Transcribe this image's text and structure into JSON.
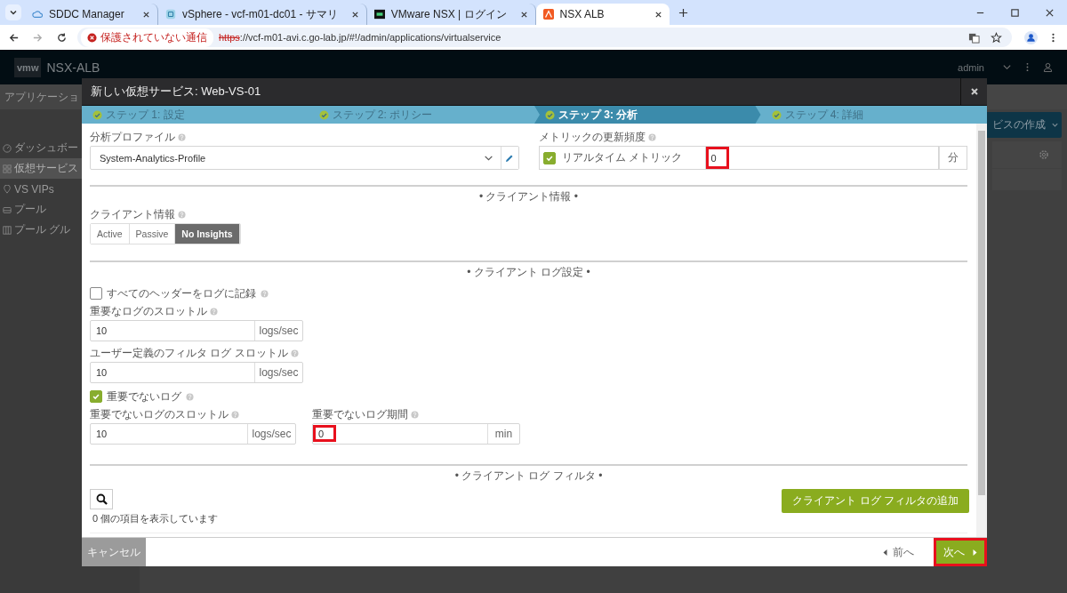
{
  "browser": {
    "tabs": [
      {
        "title": "SDDC Manager",
        "selected": false
      },
      {
        "title": "vSphere - vcf-m01-dc01 - サマリ",
        "selected": false
      },
      {
        "title": "VMware NSX | ログイン",
        "selected": false
      },
      {
        "title": "NSX ALB",
        "selected": true
      }
    ],
    "security": "保護されていない通信",
    "scheme": "https",
    "url_rest": "://vcf-m01-avi.c.go-lab.jp/#!/admin/applications/virtualservice"
  },
  "app": {
    "logo": "vmw",
    "brand": "NSX-ALB",
    "user": "admin",
    "nav_tab": "アプリケーショ",
    "sidebar": [
      {
        "label": "ダッシュボー",
        "selected": false
      },
      {
        "label": "仮想サービス",
        "selected": true
      },
      {
        "label": "VS VIPs",
        "selected": false
      },
      {
        "label": "プール",
        "selected": false
      },
      {
        "label": "プール グル",
        "selected": false
      }
    ],
    "create_button": "ビスの作成"
  },
  "modal": {
    "title": "新しい仮想サービス: Web-VS-01",
    "steps": [
      {
        "label": "ステップ 1: 設定",
        "selected": false
      },
      {
        "label": "ステップ 2: ポリシー",
        "selected": false
      },
      {
        "label": "ステップ 3: 分析",
        "selected": true
      },
      {
        "label": "ステップ 4: 詳細",
        "selected": false
      }
    ],
    "analytics_profile": {
      "label": "分析プロファイル",
      "value": "System-Analytics-Profile"
    },
    "metrics": {
      "label": "メトリックの更新頻度",
      "checkbox_label": "リアルタイム メトリック",
      "checked": true,
      "value": "0",
      "unit": "分",
      "highlighted": true
    },
    "client_insights": {
      "heading": "• クライアント情報 •",
      "label": "クライアント情報",
      "options": [
        {
          "label": "Active",
          "selected": false
        },
        {
          "label": "Passive",
          "selected": false
        },
        {
          "label": "No Insights",
          "selected": true
        }
      ]
    },
    "log_settings": {
      "heading": "• クライアント ログ設定 •",
      "log_all_headers": {
        "label": "すべてのヘッダーをログに記録",
        "checked": false
      },
      "significant_throttle": {
        "label": "重要なログのスロットル",
        "value": "10",
        "unit": "logs/sec",
        "highlighted": false
      },
      "filter_throttle": {
        "label": "ユーザー定義のフィルタ ログ スロットル",
        "value": "10",
        "unit": "logs/sec",
        "highlighted": false
      },
      "non_significant": {
        "label": "重要でないログ",
        "checked": true
      },
      "non_significant_throttle": {
        "label": "重要でないログのスロットル",
        "value": "10",
        "unit": "logs/sec",
        "highlighted": false
      },
      "non_significant_duration": {
        "label": "重要でないログ期間",
        "value": "0",
        "unit": "min",
        "highlighted": true
      }
    },
    "log_filter": {
      "heading": "• クライアント ログ フィルタ •",
      "count_text": "0 個の項目を表示しています",
      "add_button": "クライアント ログ フィルタの追加"
    },
    "footer": {
      "cancel": "キャンセル",
      "prev": "前へ",
      "next": "次へ",
      "next_highlighted": true
    }
  }
}
